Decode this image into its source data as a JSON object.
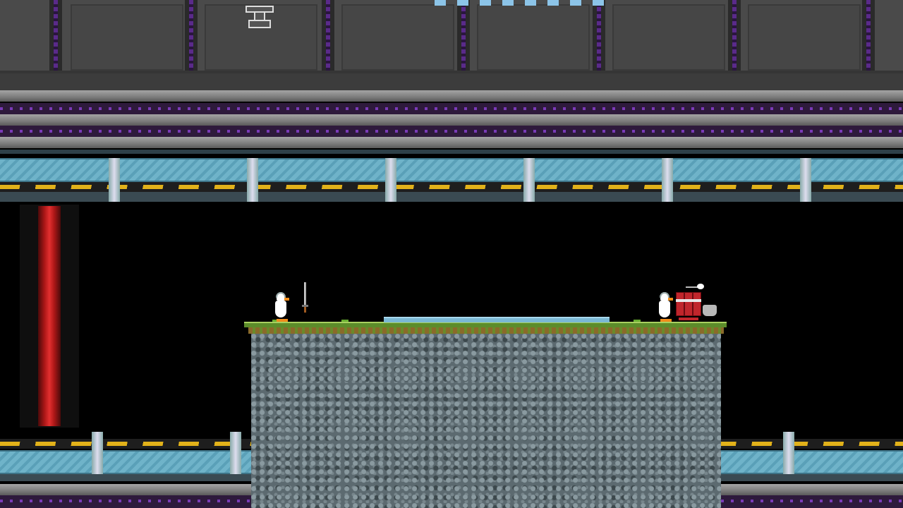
{
  "scene": {
    "type": "side-scrolling platform arena",
    "entities": [
      {
        "name": "player-duck-left",
        "holding": "none"
      },
      {
        "name": "sword-weapon"
      },
      {
        "name": "player-duck-right"
      },
      {
        "name": "dynamite-bundle"
      },
      {
        "name": "chest-armor"
      },
      {
        "name": "anvil-prop"
      }
    ],
    "hazards": [
      "red-laser-beam"
    ]
  },
  "colors": {
    "ceiling": "#4a4a4a",
    "glass": "#6fb3c9",
    "hazard_stripe": "#e2b21a",
    "laser": "#e23030",
    "grass": "#5c8c2a",
    "rock": "#5c6a70",
    "accent_purple": "#7a3ab8"
  },
  "icons": {
    "anvil": "anvil-icon",
    "sword": "sword-icon",
    "dynamite": "dynamite-icon",
    "armor": "armor-icon"
  }
}
